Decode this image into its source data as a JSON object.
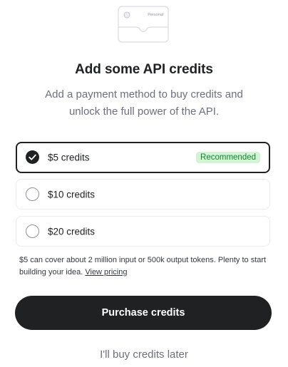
{
  "illustration": {
    "card_label": "Personal"
  },
  "header": {
    "title": "Add some API credits",
    "subtitle": "Add a payment method to buy credits and unlock the full power of the API."
  },
  "options": [
    {
      "label": "$5 credits",
      "selected": true,
      "badge": "Recommended"
    },
    {
      "label": "$10 credits",
      "selected": false
    },
    {
      "label": "$20 credits",
      "selected": false
    }
  ],
  "note": {
    "text": "$5 can cover about 2 million input or 500k output tokens. Plenty to start building your idea.",
    "link_label": "View pricing"
  },
  "actions": {
    "purchase_label": "Purchase credits",
    "later_label": "I'll buy credits later"
  },
  "colors": {
    "primary": "#202123",
    "badge_bg": "#d2f4d3",
    "badge_text": "#1a7f37",
    "muted_text": "#6e6e80"
  }
}
